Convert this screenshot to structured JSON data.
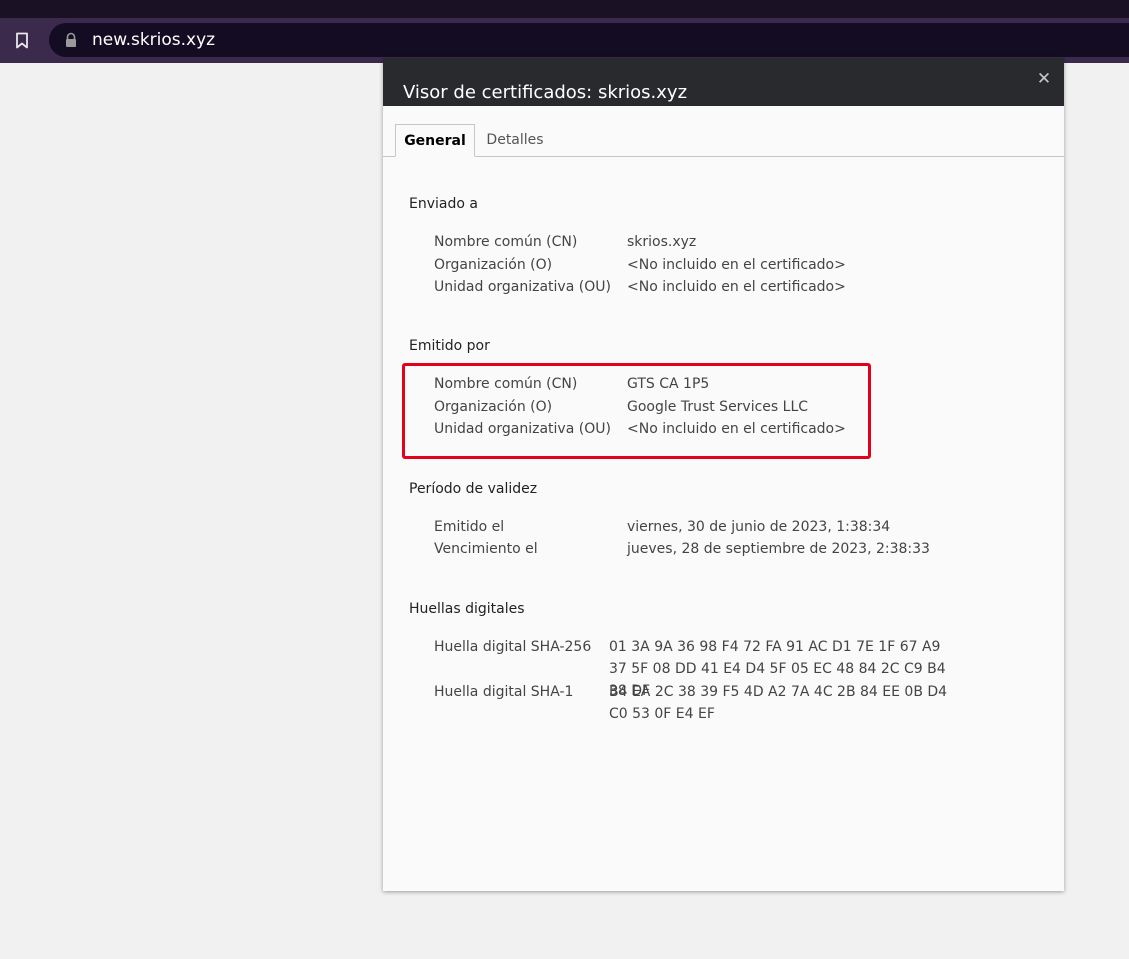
{
  "browser": {
    "url": "new.skrios.xyz"
  },
  "dialog": {
    "title": "Visor de certificados: skrios.xyz",
    "close_symbol": "✕",
    "tabs": [
      {
        "label": "General",
        "active": true
      },
      {
        "label": "Detalles",
        "active": false
      }
    ],
    "issued_to": {
      "title": "Enviado a",
      "rows": [
        {
          "label": "Nombre común (CN)",
          "value": "skrios.xyz"
        },
        {
          "label": "Organización (O)",
          "value": "<No incluido en el certificado>"
        },
        {
          "label": "Unidad organizativa (OU)",
          "value": "<No incluido en el certificado>"
        }
      ]
    },
    "issued_by": {
      "title": "Emitido por",
      "rows": [
        {
          "label": "Nombre común (CN)",
          "value": "GTS CA 1P5"
        },
        {
          "label": "Organización (O)",
          "value": "Google Trust Services LLC"
        },
        {
          "label": "Unidad organizativa (OU)",
          "value": "<No incluido en el certificado>"
        }
      ]
    },
    "validity": {
      "title": "Período de validez",
      "rows": [
        {
          "label": "Emitido el",
          "value": "viernes, 30 de junio de 2023, 1:38:34"
        },
        {
          "label": "Vencimiento el",
          "value": "jueves, 28 de septiembre de 2023, 2:38:33"
        }
      ]
    },
    "fingerprints": {
      "title": "Huellas digitales",
      "rows": [
        {
          "label": "Huella digital SHA-256",
          "value": "01 3A 9A 36 98 F4 72 FA 91 AC D1 7E 1F 67 A9 37 5F 08 DD 41 E4 D4 5F 05 EC 48 84 2C C9 B4 38 DF"
        },
        {
          "label": "Huella digital SHA-1",
          "value": "B4 EA 2C 38 39 F5 4D A2 7A 4C 2B 84 EE 0B D4 C0 53 0F E4 EF"
        }
      ]
    }
  },
  "colors": {
    "highlight": "#e2001a",
    "header_bg": "#292a2d",
    "toolbar_bg": "#3b2a4b"
  }
}
